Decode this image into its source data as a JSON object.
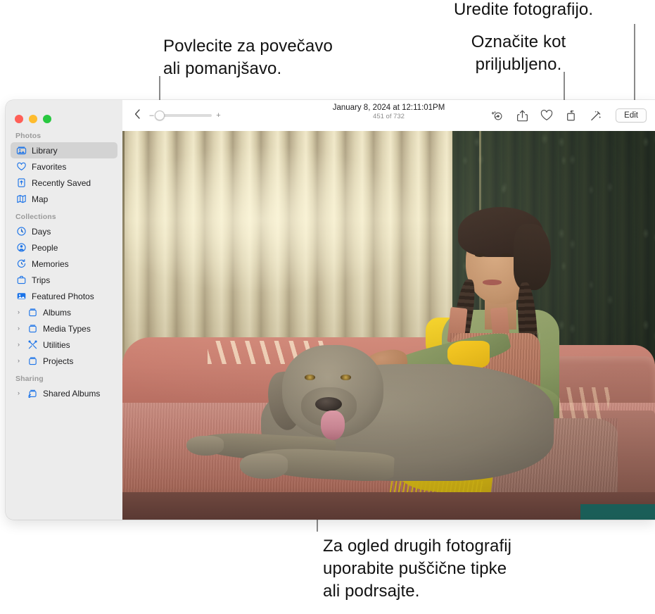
{
  "callouts": {
    "zoom": "Povlecite za povečavo\nali pomanjšavo.",
    "favorite": "Označite kot\npriljubljeno.",
    "edit": "Uredite fotografijo.",
    "arrows": "Za ogled drugih fotografij\nuporabite puščične tipke\nali podrsajte."
  },
  "window": {
    "traffic_lights": {
      "close": "close-button",
      "minimize": "minimize-button",
      "zoom": "zoom-button"
    }
  },
  "sidebar": {
    "sections": [
      {
        "title": "Photos",
        "items": [
          {
            "label": "Library",
            "icon": "library-icon",
            "selected": true,
            "disclosure": false
          },
          {
            "label": "Favorites",
            "icon": "heart-icon",
            "selected": false,
            "disclosure": false
          },
          {
            "label": "Recently Saved",
            "icon": "recently-saved-icon",
            "selected": false,
            "disclosure": false
          },
          {
            "label": "Map",
            "icon": "map-icon",
            "selected": false,
            "disclosure": false
          }
        ]
      },
      {
        "title": "Collections",
        "items": [
          {
            "label": "Days",
            "icon": "clock-icon",
            "selected": false,
            "disclosure": false
          },
          {
            "label": "People",
            "icon": "person-icon",
            "selected": false,
            "disclosure": false
          },
          {
            "label": "Memories",
            "icon": "memories-icon",
            "selected": false,
            "disclosure": false
          },
          {
            "label": "Trips",
            "icon": "trips-icon",
            "selected": false,
            "disclosure": false
          },
          {
            "label": "Featured Photos",
            "icon": "featured-photos-icon",
            "selected": false,
            "disclosure": false
          },
          {
            "label": "Albums",
            "icon": "album-icon",
            "selected": false,
            "disclosure": true
          },
          {
            "label": "Media Types",
            "icon": "album-icon",
            "selected": false,
            "disclosure": true
          },
          {
            "label": "Utilities",
            "icon": "utilities-icon",
            "selected": false,
            "disclosure": true
          },
          {
            "label": "Projects",
            "icon": "album-icon",
            "selected": false,
            "disclosure": true
          }
        ]
      },
      {
        "title": "Sharing",
        "items": [
          {
            "label": "Shared Albums",
            "icon": "shared-album-icon",
            "selected": false,
            "disclosure": true
          }
        ]
      }
    ]
  },
  "toolbar": {
    "back_icon": "chevron-left-icon",
    "zoom_out_label": "–",
    "zoom_in_label": "+",
    "zoom_value": 0,
    "date": "January 8, 2024 at 12:11:01PM",
    "counter": "451 of 732",
    "actions": [
      {
        "name": "live-photo-icon",
        "label": "Live Photo"
      },
      {
        "name": "share-icon",
        "label": "Share"
      },
      {
        "name": "heart-icon",
        "label": "Favorite"
      },
      {
        "name": "rotate-icon",
        "label": "Rotate"
      },
      {
        "name": "enhance-icon",
        "label": "Auto Enhance"
      }
    ],
    "edit_label": "Edit"
  },
  "photo": {
    "alt": "Girl with braids petting a Weimaraner dog on a coral sofa",
    "colors": {
      "blinds": "#d9cfae",
      "wall": "#2e3a2c",
      "couch": "#c8836f",
      "blanket": "#e8c618",
      "dog": "#8d8472",
      "shirt": "#8a9a60",
      "overalls": "#b87761"
    }
  }
}
